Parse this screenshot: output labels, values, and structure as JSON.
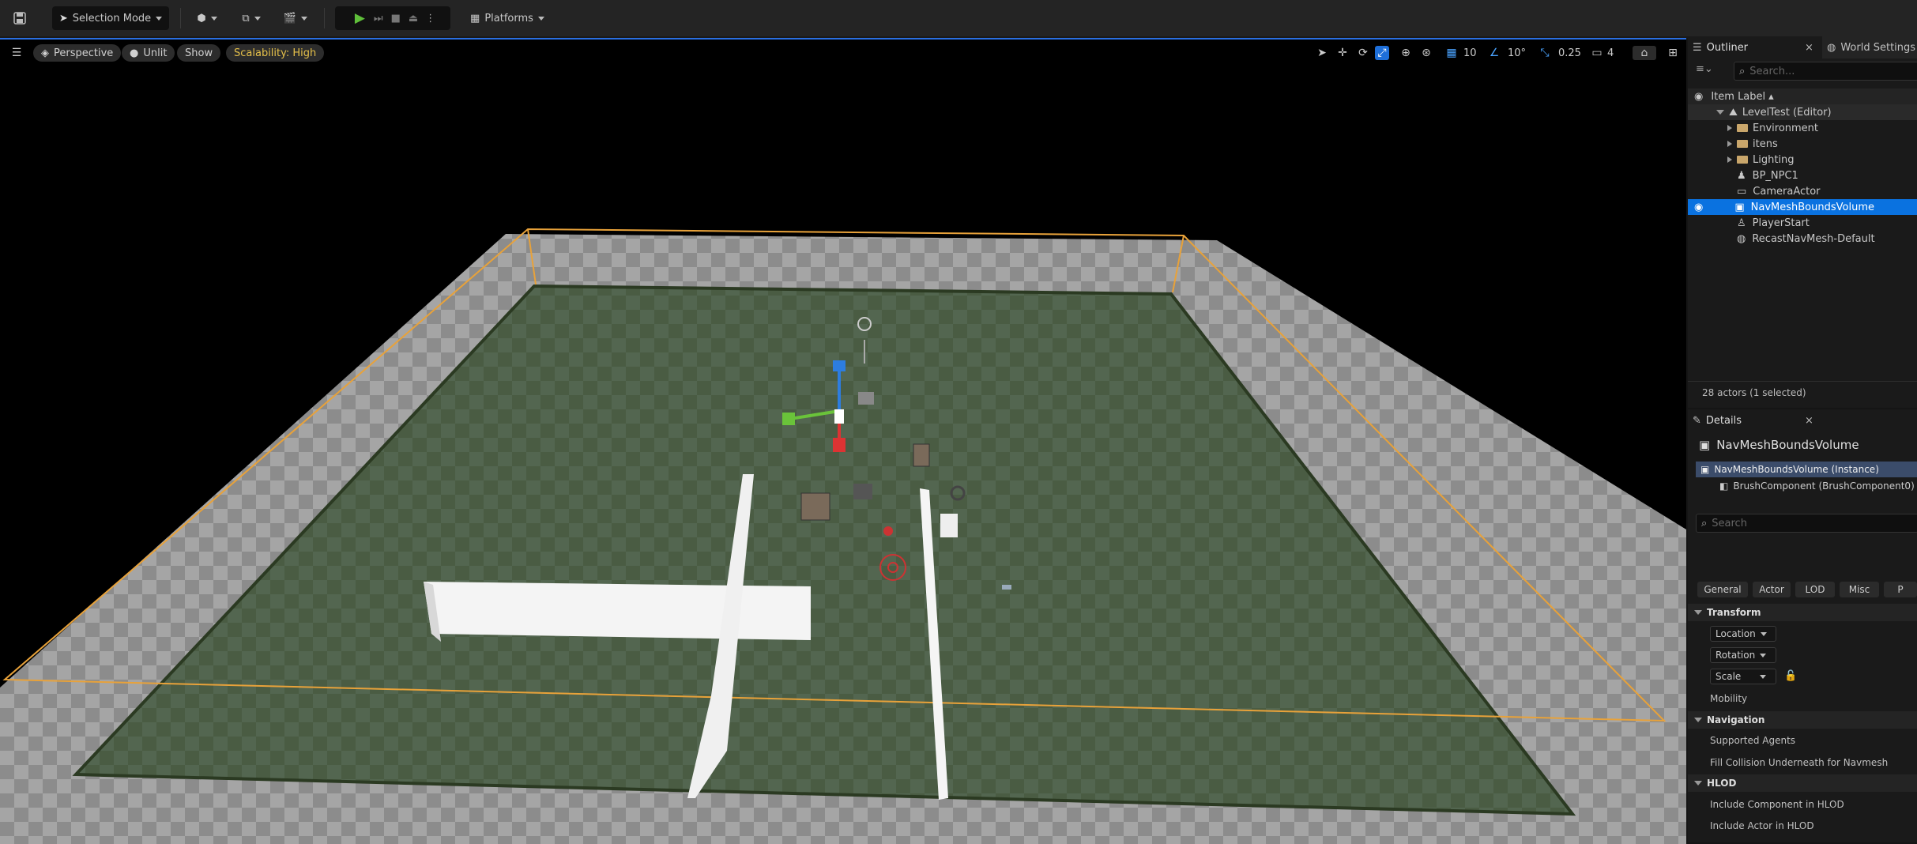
{
  "toolbar": {
    "selection_mode": "Selection Mode",
    "platforms": "Platforms"
  },
  "viewport": {
    "perspective": "Perspective",
    "unlit": "Unlit",
    "show": "Show",
    "scalability": "Scalability: High",
    "grid_snap": "10",
    "rotation_snap": "10°",
    "scale_snap": "0.25",
    "camera_speed": "4"
  },
  "outliner": {
    "tab": "Outliner",
    "world_settings_tab": "World Settings",
    "search_placeholder": "Search...",
    "column_header": "Item Label",
    "root": "LevelTest (Editor)",
    "items": [
      {
        "label": "Environment",
        "type": "folder"
      },
      {
        "label": "itens",
        "type": "folder"
      },
      {
        "label": "Lighting",
        "type": "folder"
      },
      {
        "label": "BP_NPC1",
        "type": "actor"
      },
      {
        "label": "CameraActor",
        "type": "actor"
      },
      {
        "label": "NavMeshBoundsVolume",
        "type": "actor"
      },
      {
        "label": "PlayerStart",
        "type": "actor"
      },
      {
        "label": "RecastNavMesh-Default",
        "type": "actor"
      }
    ],
    "status": "28 actors (1 selected)"
  },
  "details": {
    "tab": "Details",
    "actor_name": "NavMeshBoundsVolume",
    "instance_row": "NavMeshBoundsVolume (Instance)",
    "component_row": "BrushComponent (BrushComponent0)",
    "search_placeholder": "Search",
    "filters": [
      "General",
      "Actor",
      "LOD",
      "Misc",
      "P"
    ],
    "sections": {
      "transform": "Transform",
      "navigation": "Navigation",
      "hlod": "HLOD"
    },
    "location": "Location",
    "rotation": "Rotation",
    "scale": "Scale",
    "mobility": "Mobility",
    "supported_agents": "Supported Agents",
    "fill_collision": "Fill Collision Underneath for Navmesh",
    "include_component": "Include Component in HLOD",
    "include_actor": "Include Actor in HLOD"
  },
  "colors": {
    "accent": "#0a72e0",
    "bounds": "#e8a23a",
    "navmesh": "#4b5e44",
    "scalability": "#e5c04a"
  }
}
